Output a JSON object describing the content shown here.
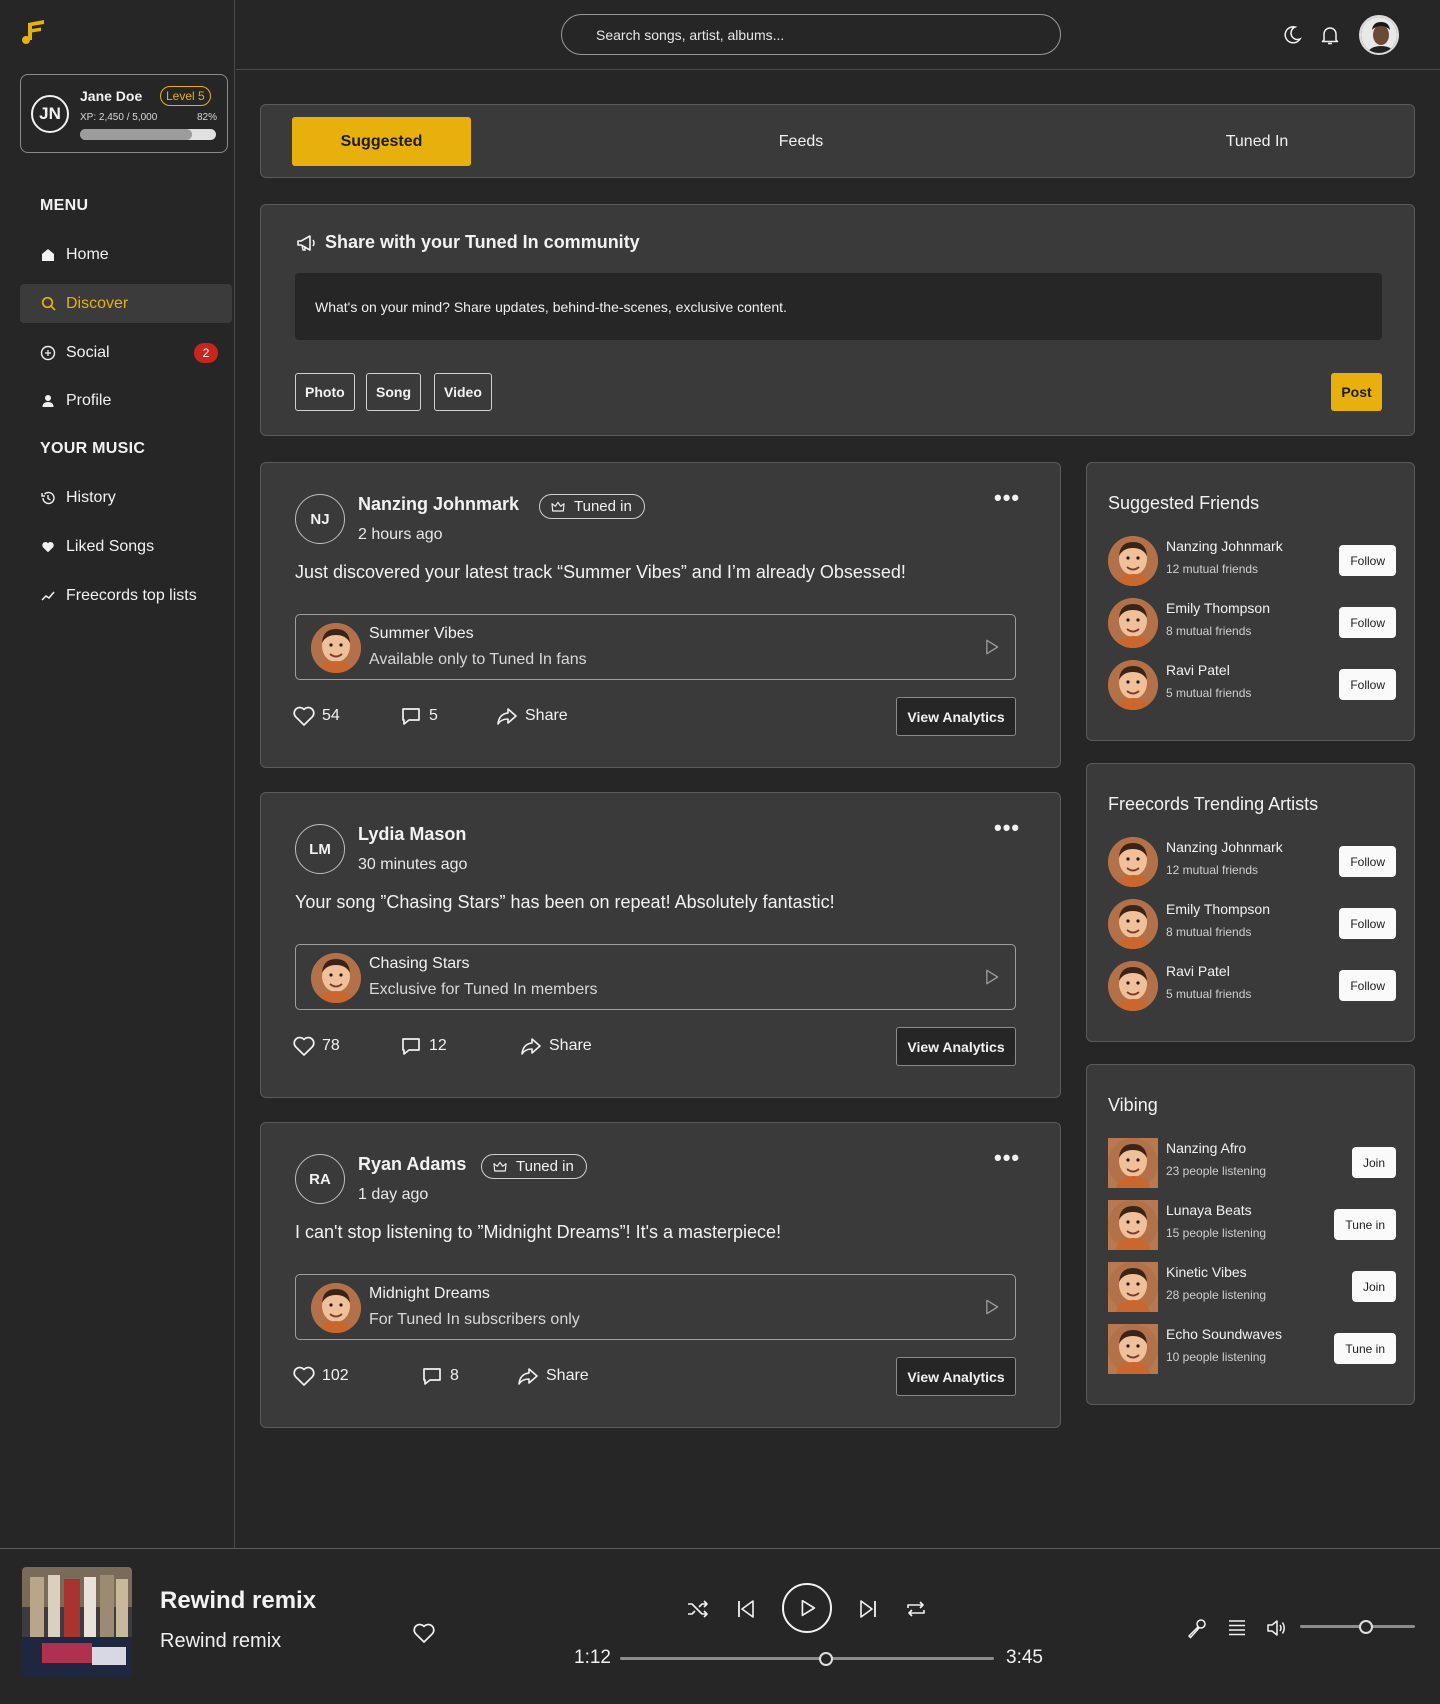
{
  "colors": {
    "accent": "#e7b00d",
    "background": "#262626",
    "card": "#3a3a3a",
    "badge": "#c6261e"
  },
  "user": {
    "initials": "JN",
    "name": "Jane Doe",
    "level": "Level 5",
    "xp_text": "XP: 2,450 / 5,000",
    "xp_percent": "82%",
    "xp_fraction": 0.82
  },
  "sidebar": {
    "menu_heading": "MENU",
    "menu_items": [
      {
        "label": "Home",
        "icon": "home-icon"
      },
      {
        "label": "Discover",
        "icon": "search-icon",
        "active": true
      },
      {
        "label": "Social",
        "icon": "chat-icon",
        "badge": "2"
      },
      {
        "label": "Profile",
        "icon": "person-icon"
      }
    ],
    "music_heading": "YOUR MUSIC",
    "music_items": [
      {
        "label": "History",
        "icon": "history-icon"
      },
      {
        "label": "Liked Songs",
        "icon": "heart-icon"
      },
      {
        "label": "Freecords top lists",
        "icon": "trending-icon"
      }
    ]
  },
  "header": {
    "search_placeholder": "Search songs, artist, albums..."
  },
  "tabs": [
    {
      "label": "Suggested",
      "active": true
    },
    {
      "label": "Feeds"
    },
    {
      "label": "Tuned In"
    }
  ],
  "composer": {
    "title": "Share with your  Tuned In community",
    "placeholder": "What's on your mind? Share updates, behind-the-scenes, exclusive content.",
    "chips": [
      "Photo",
      "Song",
      "Video"
    ],
    "post_label": "Post"
  },
  "posts": [
    {
      "initials": "NJ",
      "name": "Nanzing Johnmark",
      "badge": "Tuned in",
      "time": "2 hours ago",
      "text": "Just discovered your latest track “Summer Vibes” and I’m already Obsessed!",
      "track_title": "Summer Vibes",
      "track_sub": "Available only to Tuned In fans",
      "likes": "54",
      "comments": "5",
      "share": "Share",
      "analytics": "View Analytics"
    },
    {
      "initials": "LM",
      "name": "Lydia Mason",
      "badge": "",
      "time": "30 minutes ago",
      "text": "Your song ”Chasing Stars” has been on repeat! Absolutely fantastic!",
      "track_title": "Chasing Stars",
      "track_sub": "Exclusive for Tuned In members",
      "likes": "78",
      "comments": "12",
      "share": "Share",
      "analytics": "View Analytics"
    },
    {
      "initials": "RA",
      "name": "Ryan Adams",
      "badge": "Tuned in",
      "time": "1 day ago",
      "text": "I can't stop listening to ”Midnight Dreams”! It's a masterpiece!",
      "track_title": "Midnight Dreams",
      "track_sub": "For Tuned In subscribers only",
      "likes": "102",
      "comments": "8",
      "share": "Share",
      "analytics": "View Analytics"
    }
  ],
  "suggested_friends": {
    "title": "Suggested Friends",
    "items": [
      {
        "name": "Nanzing Johnmark",
        "sub": "12 mutual friends",
        "action": "Follow"
      },
      {
        "name": "Emily Thompson",
        "sub": "8 mutual friends",
        "action": "Follow"
      },
      {
        "name": "Ravi Patel",
        "sub": "5 mutual friends",
        "action": "Follow"
      }
    ]
  },
  "trending_artists": {
    "title": "Freecords Trending Artists",
    "items": [
      {
        "name": "Nanzing Johnmark",
        "sub": "12 mutual friends",
        "action": "Follow"
      },
      {
        "name": "Emily Thompson",
        "sub": "8 mutual friends",
        "action": "Follow"
      },
      {
        "name": "Ravi Patel",
        "sub": "5 mutual friends",
        "action": "Follow"
      }
    ]
  },
  "vibing": {
    "title": "Vibing",
    "items": [
      {
        "name": "Nanzing Afro",
        "sub": "23 people listening",
        "action": "Join"
      },
      {
        "name": "Lunaya Beats",
        "sub": "15 people listening",
        "action": "Tune in"
      },
      {
        "name": "Kinetic Vibes",
        "sub": "28 people listening",
        "action": "Join"
      },
      {
        "name": "Echo Soundwaves",
        "sub": "10 people listening",
        "action": "Tune in"
      }
    ]
  },
  "player": {
    "title": "Rewind remix",
    "artist": "Rewind remix",
    "current_time": "1:12",
    "total_time": "3:45",
    "progress": 0.55,
    "volume": 0.57
  }
}
